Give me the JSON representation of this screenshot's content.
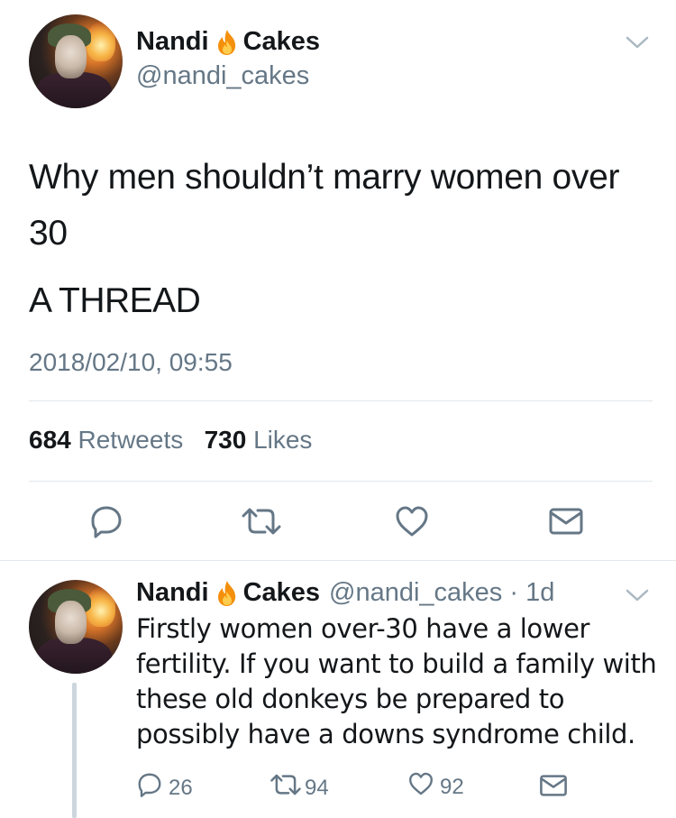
{
  "tweet": {
    "author_name_first": "Nandi",
    "author_name_last": "Cakes",
    "author_handle": "@nandi_cakes",
    "text_line": "Why men shouldn’t marry women over 30",
    "text_thread": "A THREAD",
    "timestamp": "2018/02/10, 09:55",
    "retweets_count": "684",
    "retweets_label": "Retweets",
    "likes_count": "730",
    "likes_label": "Likes"
  },
  "reply": {
    "author_name_first": "Nandi",
    "author_name_last": "Cakes",
    "meta": "@nandi_cakes · 1d",
    "text": "Firstly women over-30 have a lower fertility. If you want to build a family with these old donkeys be prepared to possibly have a downs syndrome child.",
    "reply_count": "26",
    "retweet_count": "94",
    "like_count": "92"
  },
  "icons": {
    "name_emoji": "fire-icon",
    "menu": "chevron-down-icon",
    "reply": "reply-icon",
    "retweet": "retweet-icon",
    "like": "heart-icon",
    "dm": "envelope-icon"
  },
  "colors": {
    "secondary_text": "#657786",
    "divider": "#e1e8ed",
    "thread_line": "#ccd6dd"
  }
}
